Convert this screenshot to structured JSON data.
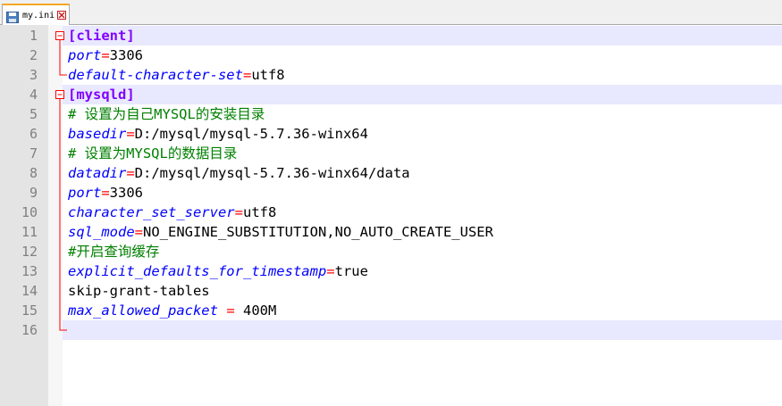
{
  "tab": {
    "filename": "my.ini",
    "icon": "save-file-icon",
    "close_icon": "close-icon"
  },
  "colors": {
    "section": "#8000ff",
    "key": "#0000ff",
    "equals": "#ff0000",
    "comment": "#008000",
    "line_highlight": "#e8e8ff",
    "fold_marker": "#ff0000"
  },
  "lines": [
    {
      "n": "1",
      "section": "[client]"
    },
    {
      "n": "2",
      "key": "port",
      "eq": "=",
      "value": "3306"
    },
    {
      "n": "3",
      "key": "default-character-set",
      "eq": "=",
      "value": "utf8"
    },
    {
      "n": "4",
      "section": "[mysqld]"
    },
    {
      "n": "5",
      "comment": "# 设置为自己MYSQL的安装目录"
    },
    {
      "n": "6",
      "key": "basedir",
      "eq": "=",
      "value": "D:/mysql/mysql-5.7.36-winx64"
    },
    {
      "n": "7",
      "comment": "# 设置为MYSQL的数据目录"
    },
    {
      "n": "8",
      "key": "datadir",
      "eq": "=",
      "value": "D:/mysql/mysql-5.7.36-winx64/data"
    },
    {
      "n": "9",
      "key": "port",
      "eq": "=",
      "value": "3306"
    },
    {
      "n": "10",
      "key": "character_set_server",
      "eq": "=",
      "value": "utf8"
    },
    {
      "n": "11",
      "key": "sql_mode",
      "eq": "=",
      "value": "NO_ENGINE_SUBSTITUTION,NO_AUTO_CREATE_USER"
    },
    {
      "n": "12",
      "comment": "#开启查询缓存"
    },
    {
      "n": "13",
      "key": "explicit_defaults_for_timestamp",
      "eq": "=",
      "value": "true"
    },
    {
      "n": "14",
      "plain": "skip-grant-tables"
    },
    {
      "n": "15",
      "key": "max_allowed_packet",
      "pre": " ",
      "eq": "=",
      "value": " 400M"
    },
    {
      "n": "16",
      "plain": ""
    }
  ]
}
